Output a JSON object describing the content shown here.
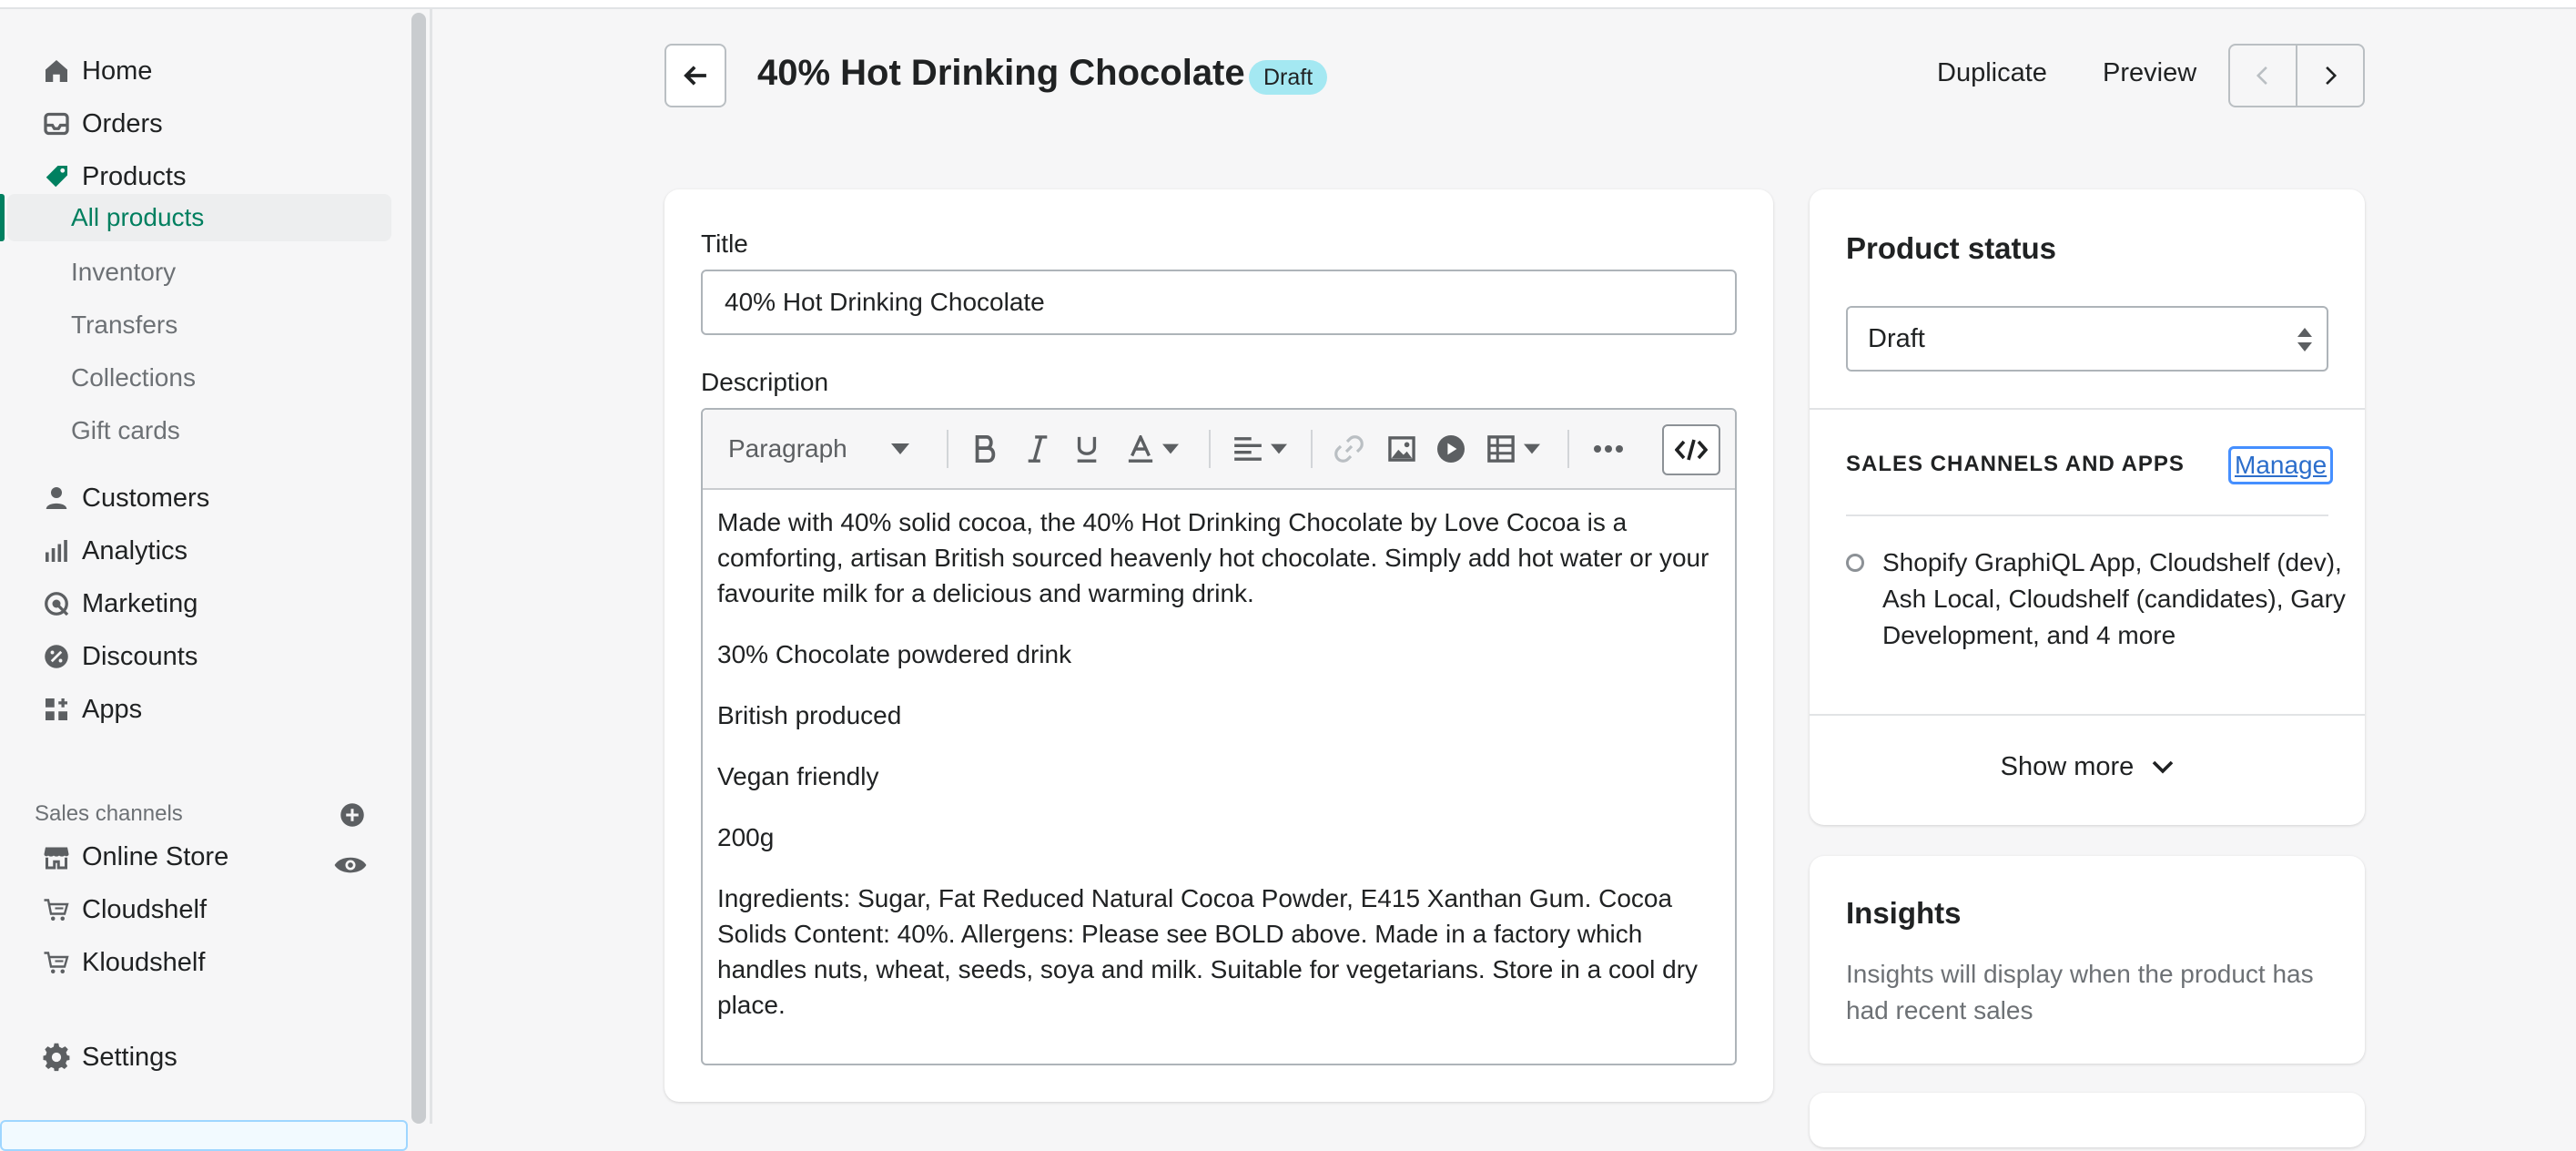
{
  "sidebar": {
    "items": [
      {
        "label": "Home",
        "icon": "home-icon"
      },
      {
        "label": "Orders",
        "icon": "inbox-icon"
      },
      {
        "label": "Products",
        "icon": "tag-icon"
      }
    ],
    "product_sub": [
      {
        "label": "All products"
      },
      {
        "label": "Inventory"
      },
      {
        "label": "Transfers"
      },
      {
        "label": "Collections"
      },
      {
        "label": "Gift cards"
      }
    ],
    "items2": [
      {
        "label": "Customers",
        "icon": "person-icon"
      },
      {
        "label": "Analytics",
        "icon": "bar-chart-icon"
      },
      {
        "label": "Marketing",
        "icon": "target-icon"
      },
      {
        "label": "Discounts",
        "icon": "discount-icon"
      },
      {
        "label": "Apps",
        "icon": "apps-icon"
      }
    ],
    "sales_channels_label": "Sales channels",
    "channels": [
      {
        "label": "Online Store",
        "icon": "store-icon"
      },
      {
        "label": "Cloudshelf",
        "icon": "cart-icon"
      },
      {
        "label": "Kloudshelf",
        "icon": "cart-icon"
      }
    ],
    "settings_label": "Settings"
  },
  "header": {
    "title": "40% Hot Drinking Chocolate",
    "badge": "Draft",
    "duplicate": "Duplicate",
    "preview": "Preview"
  },
  "product": {
    "title_label": "Title",
    "title_value": "40% Hot Drinking Chocolate",
    "description_label": "Description",
    "editor": {
      "format": "Paragraph",
      "paragraphs": [
        "Made with 40% solid cocoa, the 40% Hot Drinking Chocolate by Love Cocoa is a comforting, artisan British sourced heavenly hot chocolate. Simply add hot water or your favourite milk for a delicious and warming drink.",
        "30% Chocolate powdered drink",
        "British produced",
        "Vegan friendly",
        "200g",
        "Ingredients: Sugar, Fat Reduced Natural Cocoa Powder, E415 Xanthan Gum. Cocoa Solids Content: 40%. Allergens: Please see BOLD above. Made in a factory which handles nuts, wheat, seeds, soya and milk. Suitable for vegetarians. Store in a cool dry place."
      ]
    }
  },
  "status": {
    "title": "Product status",
    "selected": "Draft",
    "channels_label": "SALES CHANNELS AND APPS",
    "manage": "Manage",
    "channels_text": "Shopify GraphiQL App, Cloudshelf (dev), Ash Local, Cloudshelf (candidates), Gary Development, and 4 more",
    "show_more": "Show more"
  },
  "insights": {
    "title": "Insights",
    "text": "Insights will display when the product has had recent sales"
  },
  "colors": {
    "accent": "#008060",
    "badge": "#a4e8f2",
    "link": "#2c6ecb"
  }
}
